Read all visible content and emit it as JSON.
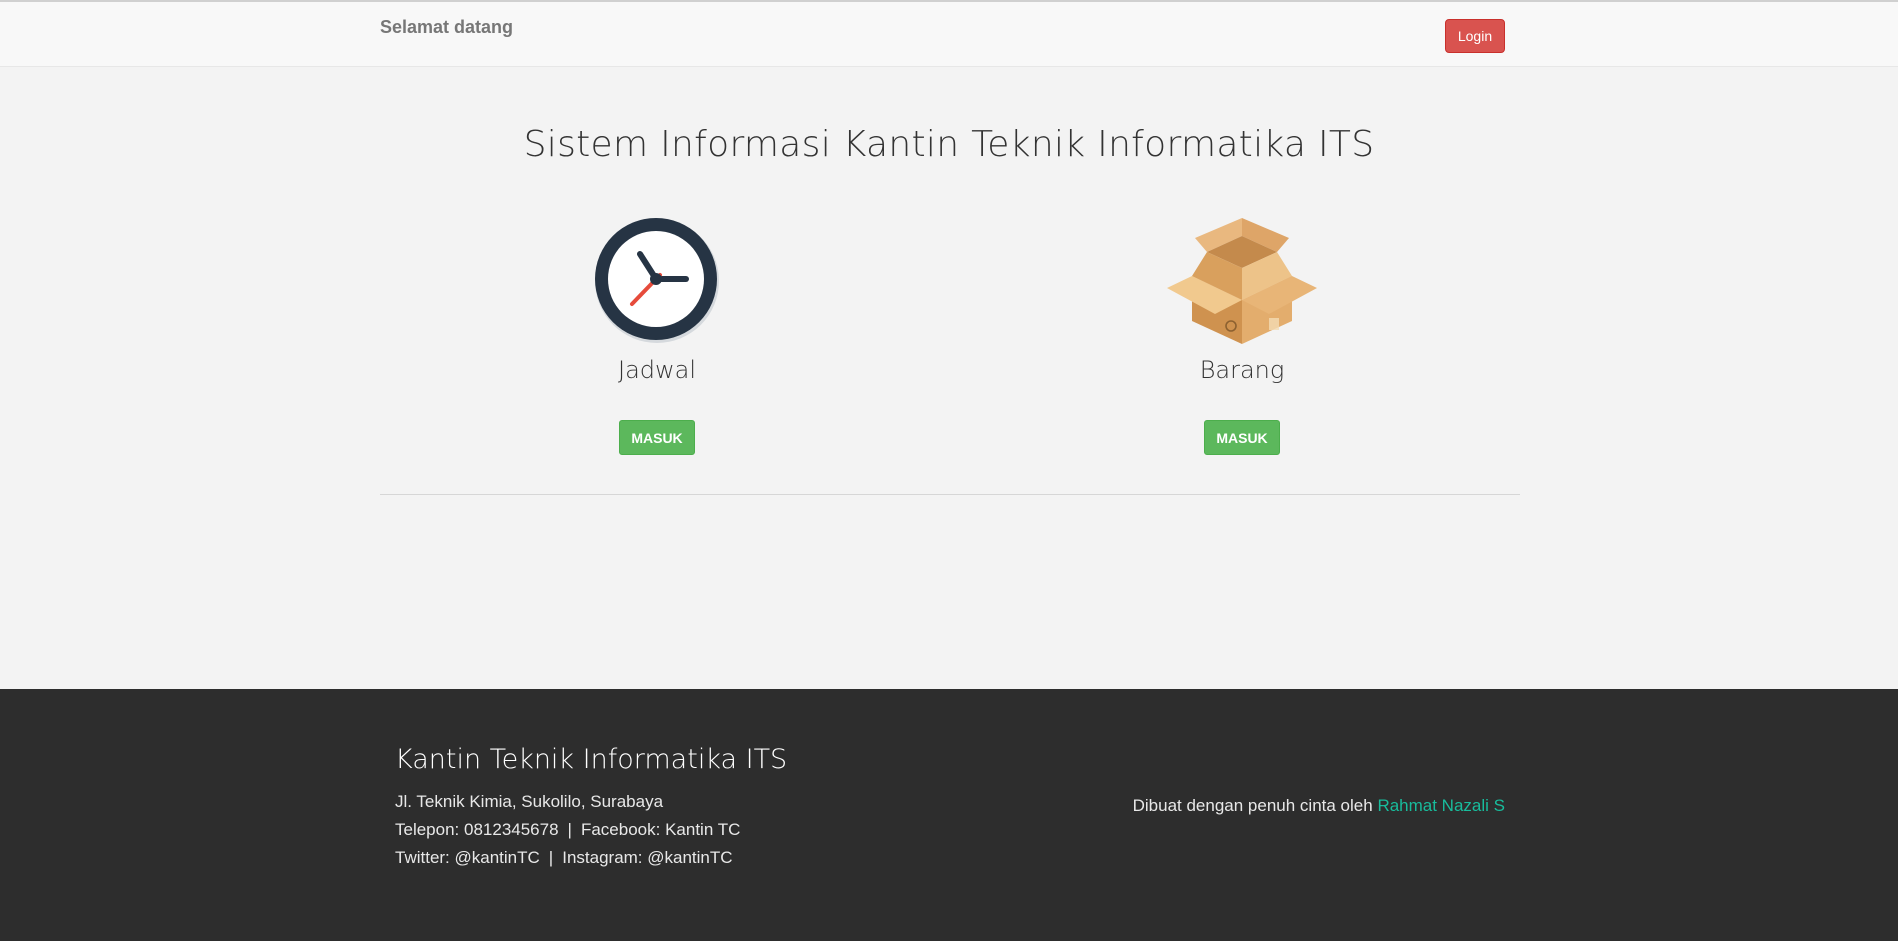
{
  "navbar": {
    "brand": "Selamat datang",
    "login_label": "Login"
  },
  "hero": {
    "title": "Sistem Informasi Kantin Teknik Informatika ITS"
  },
  "features": [
    {
      "label": "Jadwal",
      "icon": "clock-icon",
      "button_label": "MASUK"
    },
    {
      "label": "Barang",
      "icon": "box-icon",
      "button_label": "MASUK"
    }
  ],
  "footer": {
    "title": "Kantin Teknik Informatika ITS",
    "address": "Jl. Teknik Kimia, Sukolilo, Surabaya",
    "telepon": "Telepon: 0812345678",
    "facebook": "Facebook: Kantin TC",
    "twitter": "Twitter: @kantinTC",
    "instagram": "Instagram: @kantinTC",
    "separator": "|",
    "credit_prefix": "Dibuat dengan penuh cinta oleh",
    "credit_name": "Rahmat Nazali S"
  },
  "colors": {
    "login": "#d9534f",
    "masuk": "#5cb85c",
    "footer_bg": "#2d2d2d",
    "link": "#18bc9c"
  }
}
